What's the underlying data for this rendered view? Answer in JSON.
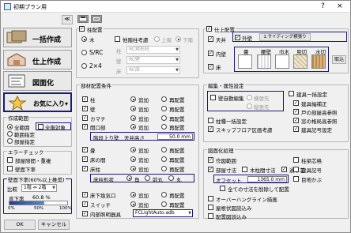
{
  "window": {
    "title": "初期プラン用",
    "help": "?",
    "close": "×"
  },
  "left": {
    "collapse": "≪",
    "btn_bulk": "一括作成",
    "btn_finish": "仕上作成",
    "btn_draw": "図面化",
    "btn_fav": "お気に入り▾",
    "area_title": "作成範囲",
    "area_all": "全範囲",
    "area_all_sel": true,
    "area_select": "範囲指定",
    "area_room": "部屋指定",
    "area_target": "全階対象",
    "err_title": "エラーチェック",
    "err_room": "部屋隙間・重複",
    "err_step": "壁面下率",
    "wall_title": "壁面下率(60%以上推奨)",
    "ratio_label": "比較",
    "ratio_value": "1階 ⇔ 2階",
    "under_label": "直下率",
    "under_pct": "60.8 %",
    "scale0": "0%",
    "scale1": "50%",
    "scale2": "100%",
    "under_fill": 0.608,
    "ok": "OK",
    "cancel": "キャンセル"
  },
  "toolbar": {
    "icon1": "save-icon",
    "icon2": "load-icon"
  },
  "pillar": {
    "title": "柱配置",
    "wood": "木",
    "other_std": "他階柱考慮",
    "top": "上階",
    "bottom": "下階",
    "sr": "S/RC",
    "pillar_lbl": "柱",
    "pillar_val": "RC矩形柱",
    "x24": "2×4",
    "wall_lbl": "壁",
    "wall_val": "RC壁",
    "floor_lbl": "床",
    "floor_val": "RC床"
  },
  "parts": {
    "title": "部材配置条件",
    "rows": [
      {
        "label": "柱",
        "add": "追加",
        "redo": "再配置"
      },
      {
        "label": "壁",
        "add": "追加",
        "redo": "再配置"
      },
      {
        "label": "カマチ",
        "add": "追加",
        "redo": "再配置"
      },
      {
        "label": "開口部",
        "add": "追加",
        "redo": "再配置"
      }
    ],
    "wall_height_label": "階段上り壁",
    "wall_height_title": "天井高さ",
    "wall_height_val": "50.0 mm",
    "rows2": [
      {
        "label": "畳",
        "add": "追加",
        "redo": "再配置"
      },
      {
        "label": "床の間",
        "add": "追加",
        "redo": "再配置"
      },
      {
        "label": "床柱",
        "add": "追加",
        "redo": "再配置"
      }
    ],
    "pillar_shape": "床柱形状",
    "shape_square": "角",
    "shape_front": "前丸",
    "shape_round": "丸",
    "rows3": [
      {
        "label": "床下換気口",
        "add": "追加",
        "redo": "再配置"
      },
      {
        "label": "スイッチ",
        "add": "追加",
        "redo": "再配置"
      },
      {
        "label": "内部照明器具",
        "val": "FCLightAuto.adb"
      }
    ]
  },
  "finish": {
    "title": "仕上配置",
    "ceiling": "天井",
    "outer_wall": "外壁",
    "inner_wall": "内壁",
    "floor": "床",
    "btn_siding": "1.サイディング横張り",
    "tatami": "畳",
    "seam": "腰壁",
    "width": "巾木",
    "dado": "見切",
    "wood": "水切",
    "retake": "取込"
  },
  "edit": {
    "title": "編集・属性設定",
    "auto_edit": "壁自動編集",
    "horiz": "横張先",
    "vert": "縦張先",
    "reset_area": "柱種一括設定",
    "skip": "スキップフロア区画考慮",
    "right_title": "建具一括設定",
    "r1": "建具幅補正",
    "r2": "戸の部屋高参照",
    "r3": "窓の格局高参照",
    "r4": "建具記号設定"
  },
  "dims": {
    "title": "図面化処理",
    "c1": "作図範囲",
    "c2": "部屋寸法",
    "c3": "木柱間寸法",
    "c4": "通り芯",
    "offset_label": "オフセット",
    "offset_val": "1365.0 mm",
    "all_dims": "全ての寸法を削除して配置",
    "r1": "柱梁芯格",
    "r2": "建具記号",
    "r3": "目地かぶ",
    "over_hang": "オーバーハングライン描画",
    "floor_lines": "屋根伏図読込み",
    "arr_lines": "配置図読込み"
  }
}
